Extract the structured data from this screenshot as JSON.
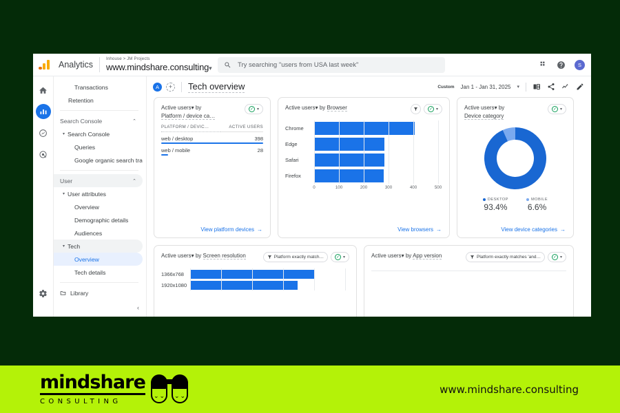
{
  "footer": {
    "brand_name": "mindshare",
    "brand_sub": "CONSULTING",
    "url": "www.mindshare.consulting",
    "band_color": "#b4f208",
    "canvas_color": "#042b08"
  },
  "header": {
    "product": "Analytics",
    "breadcrumb": "Inhouse > JM Projects",
    "property": "www.mindshare.consulting",
    "property_caret": "▾",
    "search_placeholder": "Try searching \"users from USA last week\"",
    "search_value": "",
    "avatar_initial": "S",
    "icons": [
      "apps-grid-icon",
      "help-icon",
      "avatar"
    ]
  },
  "rail": {
    "items": [
      {
        "name": "home-icon",
        "label": "Home",
        "active": false
      },
      {
        "name": "reports-icon",
        "label": "Reports",
        "active": true
      },
      {
        "name": "explore-icon",
        "label": "Explore",
        "active": false
      },
      {
        "name": "advertising-icon",
        "label": "Advertising",
        "active": false
      }
    ],
    "settings_label": "Admin"
  },
  "sidebar": {
    "items": [
      {
        "label": "Transactions",
        "level": 3,
        "type": "link"
      },
      {
        "label": "Retention",
        "level": 2,
        "type": "link"
      },
      {
        "type": "divider"
      },
      {
        "label": "Search Console",
        "level": 1,
        "type": "section",
        "chevron": "⌃",
        "filled": false
      },
      {
        "label": "Search Console",
        "level": 2,
        "type": "group",
        "caret": "▾"
      },
      {
        "label": "Queries",
        "level": 3,
        "type": "link"
      },
      {
        "label": "Google organic search traf…",
        "level": 3,
        "type": "link"
      },
      {
        "type": "divider"
      },
      {
        "label": "User",
        "level": 1,
        "type": "section",
        "chevron": "⌃",
        "filled": true
      },
      {
        "label": "User attributes",
        "level": 2,
        "type": "group",
        "caret": "▾"
      },
      {
        "label": "Overview",
        "level": 3,
        "type": "link"
      },
      {
        "label": "Demographic details",
        "level": 3,
        "type": "link"
      },
      {
        "label": "Audiences",
        "level": 3,
        "type": "link"
      },
      {
        "label": "Tech",
        "level": 2,
        "type": "group",
        "caret": "▾",
        "highlight": true
      },
      {
        "label": "Overview",
        "level": 3,
        "type": "link",
        "selected": true
      },
      {
        "label": "Tech details",
        "level": 3,
        "type": "link"
      },
      {
        "type": "divider"
      },
      {
        "label": "Library",
        "level": 1,
        "type": "library",
        "icon": "library-icon"
      }
    ],
    "collapse_glyph": "‹"
  },
  "toolbar": {
    "badge_a": "A",
    "badge_plus": "+",
    "page_title": "Tech overview",
    "date_label": "Custom",
    "date_range": "Jan 1 - Jan 31, 2025",
    "date_caret": "▾",
    "actions": [
      "compare-icon",
      "share-icon",
      "insights-icon",
      "edit-icon"
    ]
  },
  "cards": {
    "platform_table": {
      "title_metric": "Active users",
      "title_caret": "▾",
      "title_by": "by",
      "title_dim": "Platform / device ca…",
      "columns": [
        "PLATFORM / DEVIC…",
        "ACTIVE USERS"
      ],
      "rows": [
        {
          "name": "web / desktop",
          "value": "398",
          "bar_pct": 100
        },
        {
          "name": "web / mobile",
          "value": "28",
          "bar_pct": 7
        }
      ],
      "link": "View platform devices",
      "link_arrow": "→"
    },
    "browser_chart": {
      "title_metric": "Active users",
      "title_caret": "▾",
      "title_by": "by",
      "title_dim": "Browser",
      "filter_chip": "filter-icon",
      "link": "View browsers",
      "link_arrow": "→"
    },
    "device_donut": {
      "title_metric": "Active users",
      "title_caret": "▾",
      "title_by": "by",
      "title_dim": "Device category",
      "link": "View device categories",
      "link_arrow": "→"
    },
    "screen_resolution": {
      "title_metric": "Active users",
      "title_caret": "▾",
      "title_by": "by",
      "title_dim": "Screen resolution",
      "filter_chip_label": "Platform exactly match…"
    },
    "app_version": {
      "title_metric": "Active users",
      "title_caret": "▾",
      "title_by": "by",
      "title_dim": "App version",
      "filter_chip_label": "Platform exactly matches 'and…"
    }
  },
  "chart_data": [
    {
      "type": "bar",
      "orientation": "horizontal",
      "title": "Active users by Browser",
      "categories": [
        "Chrome",
        "Edge",
        "Safari",
        "Firefox"
      ],
      "values": [
        405,
        283,
        282,
        280
      ],
      "xlabel": "",
      "ylabel": "",
      "xlim": [
        0,
        500
      ],
      "xticks": [
        0,
        100,
        200,
        300,
        400,
        500
      ],
      "grid": true,
      "series_color": "#1a73e8"
    },
    {
      "type": "pie",
      "subtype": "donut",
      "title": "Active users by Device category",
      "categories": [
        "DESKTOP",
        "MOBILE"
      ],
      "values": [
        93.4,
        6.6
      ],
      "value_labels": [
        "93.4%",
        "6.6%"
      ],
      "colors": [
        "#1967d2",
        "#7aa9ef"
      ],
      "legend": "bottom"
    },
    {
      "type": "bar",
      "orientation": "horizontal",
      "title": "Active users by Screen resolution",
      "categories": [
        "1366x768",
        "1920x1080"
      ],
      "values": [
        96,
        83
      ],
      "xlim": [
        0,
        120
      ],
      "grid": true,
      "series_color": "#1a73e8"
    },
    {
      "type": "table",
      "title": "Active users by Platform / device category",
      "columns": [
        "PLATFORM / DEVIC…",
        "ACTIVE USERS"
      ],
      "rows": [
        [
          "web / desktop",
          398
        ],
        [
          "web / mobile",
          28
        ]
      ]
    }
  ]
}
